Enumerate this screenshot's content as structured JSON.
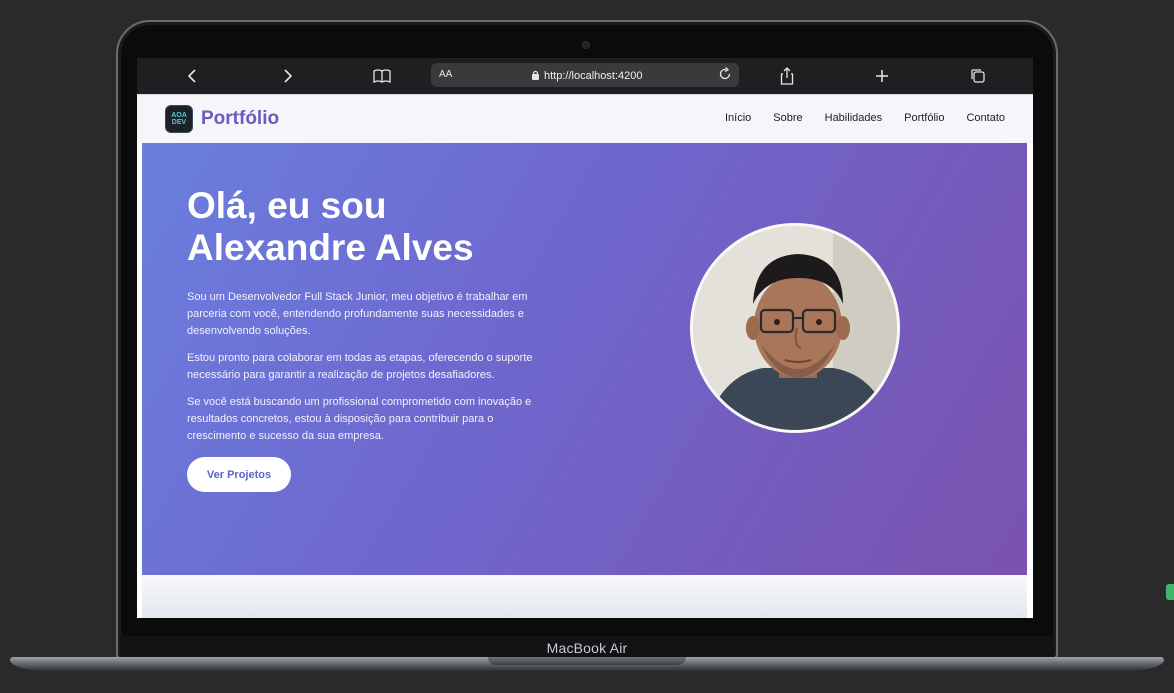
{
  "device": {
    "label": "MacBook Air"
  },
  "browser": {
    "back_icon": "chevron-left-icon",
    "forward_icon": "chevron-right-icon",
    "bookmarks_icon": "book-icon",
    "text_size": "AA",
    "url": "http://localhost:4200",
    "reload_icon": "reload-icon",
    "share_icon": "share-icon",
    "new_tab_icon": "plus-icon",
    "tabs_icon": "tabs-icon"
  },
  "site": {
    "logo_text_top": "AOA",
    "logo_text_bottom": "DEV",
    "brand": "Portfólio",
    "nav": [
      "Início",
      "Sobre",
      "Habilidades",
      "Portfólio",
      "Contato"
    ]
  },
  "hero": {
    "title_line1": "Olá, eu sou",
    "title_line2": "Alexandre Alves",
    "paragraph1": "Sou um Desenvolvedor Full Stack Junior, meu objetivo é trabalhar em parceria com você, entendendo profundamente suas necessidades e desenvolvendo soluções.",
    "paragraph2": "Estou pronto para colaborar em todas as etapas, oferecendo o suporte necessário para garantir a realização de projetos desafiadores.",
    "paragraph3": "Se você está buscando um profissional comprometido com inovação e resultados concretos, estou à disposição para contribuir para o crescimento e sucesso da sua empresa.",
    "cta": "Ver Projetos"
  },
  "colors": {
    "brand": "#6a5bc0",
    "hero_start": "#6a7fde",
    "hero_end": "#7a52ae",
    "cta_text": "#5b63c8"
  }
}
